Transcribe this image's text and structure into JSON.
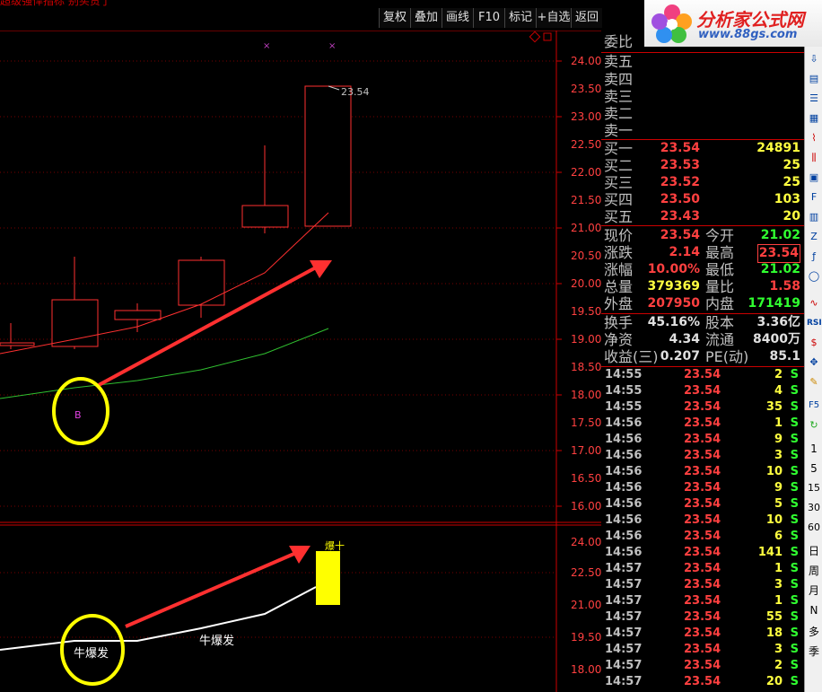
{
  "toolbar": {
    "truncated_title": "超级强悍指标 别买贵了",
    "buttons": [
      "复权",
      "叠加",
      "画线",
      "F10",
      "标记",
      "+自选",
      "返回"
    ]
  },
  "logo": {
    "name": "分析家公式网",
    "url": "www.88gs.com"
  },
  "main_chart": {
    "price_axis": [
      "24.00",
      "23.50",
      "23.00",
      "22.50",
      "22.00",
      "21.50",
      "21.00",
      "20.50",
      "20.00",
      "19.50",
      "19.00",
      "18.50",
      "18.00",
      "17.50",
      "17.00",
      "16.50",
      "16.00"
    ],
    "last_price_label": "23.54",
    "marker_label": "B"
  },
  "sub_chart": {
    "axis": [
      "24.00",
      "22.50",
      "21.00",
      "19.50",
      "18.00"
    ],
    "label_circle": "牛爆发",
    "label_line": "牛爆发",
    "bar_label": "爆十"
  },
  "quote": {
    "weibi_label": "委比",
    "sell": [
      {
        "label": "卖五"
      },
      {
        "label": "卖四"
      },
      {
        "label": "卖三"
      },
      {
        "label": "卖二"
      },
      {
        "label": "卖一"
      }
    ],
    "buy": [
      {
        "label": "买一",
        "price": "23.54",
        "vol": "24891"
      },
      {
        "label": "买二",
        "price": "23.53",
        "vol": "25"
      },
      {
        "label": "买三",
        "price": "23.52",
        "vol": "25"
      },
      {
        "label": "买四",
        "price": "23.50",
        "vol": "103"
      },
      {
        "label": "买五",
        "price": "23.43",
        "vol": "20"
      }
    ],
    "stats": [
      {
        "l1": "现价",
        "v1": "23.54",
        "l2": "今开",
        "v2": "21.02"
      },
      {
        "l1": "涨跌",
        "v1": "2.14",
        "l2": "最高",
        "v2": "23.54"
      },
      {
        "l1": "涨幅",
        "v1": "10.00%",
        "l2": "最低",
        "v2": "21.02"
      },
      {
        "l1": "总量",
        "v1": "379369",
        "l2": "量比",
        "v2": "1.58"
      },
      {
        "l1": "外盘",
        "v1": "207950",
        "l2": "内盘",
        "v2": "171419"
      }
    ],
    "fin": [
      {
        "l1": "换手",
        "v1": "45.16%",
        "l2": "股本",
        "v2": "3.36亿"
      },
      {
        "l1": "净资",
        "v1": "4.34",
        "l2": "流通",
        "v2": "8400万"
      },
      {
        "l1": "收益(三)",
        "v1": "0.207",
        "l2": "PE(动)",
        "v2": "85.1"
      }
    ]
  },
  "ticks": [
    {
      "t": "14:55",
      "p": "23.54",
      "v": "2",
      "s": "S"
    },
    {
      "t": "14:55",
      "p": "23.54",
      "v": "4",
      "s": "S"
    },
    {
      "t": "14:55",
      "p": "23.54",
      "v": "35",
      "s": "S"
    },
    {
      "t": "14:56",
      "p": "23.54",
      "v": "1",
      "s": "S"
    },
    {
      "t": "14:56",
      "p": "23.54",
      "v": "9",
      "s": "S"
    },
    {
      "t": "14:56",
      "p": "23.54",
      "v": "3",
      "s": "S"
    },
    {
      "t": "14:56",
      "p": "23.54",
      "v": "10",
      "s": "S"
    },
    {
      "t": "14:56",
      "p": "23.54",
      "v": "9",
      "s": "S"
    },
    {
      "t": "14:56",
      "p": "23.54",
      "v": "5",
      "s": "S"
    },
    {
      "t": "14:56",
      "p": "23.54",
      "v": "10",
      "s": "S"
    },
    {
      "t": "14:56",
      "p": "23.54",
      "v": "6",
      "s": "S"
    },
    {
      "t": "14:56",
      "p": "23.54",
      "v": "141",
      "s": "S"
    },
    {
      "t": "14:57",
      "p": "23.54",
      "v": "1",
      "s": "S"
    },
    {
      "t": "14:57",
      "p": "23.54",
      "v": "3",
      "s": "S"
    },
    {
      "t": "14:57",
      "p": "23.54",
      "v": "1",
      "s": "S"
    },
    {
      "t": "14:57",
      "p": "23.54",
      "v": "55",
      "s": "S"
    },
    {
      "t": "14:57",
      "p": "23.54",
      "v": "18",
      "s": "S"
    },
    {
      "t": "14:57",
      "p": "23.54",
      "v": "3",
      "s": "S"
    },
    {
      "t": "14:57",
      "p": "23.54",
      "v": "2",
      "s": "S"
    },
    {
      "t": "14:57",
      "p": "23.54",
      "v": "20",
      "s": "S"
    }
  ],
  "rightbar": [
    "RSI",
    "F5",
    "1",
    "5",
    "15",
    "30",
    "60",
    "日",
    "周",
    "月",
    "N",
    "多",
    "季"
  ]
}
